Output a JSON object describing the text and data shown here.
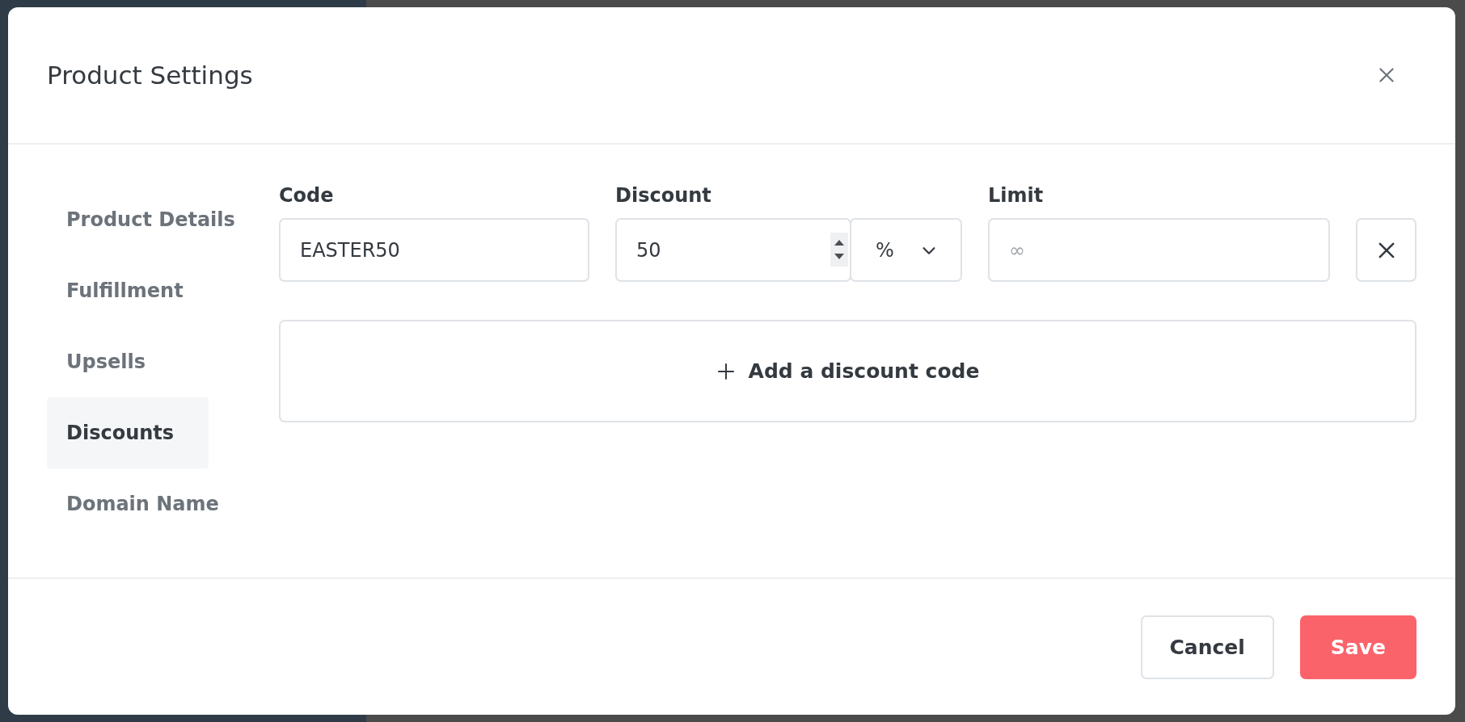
{
  "dialog": {
    "title": "Product Settings"
  },
  "sidebar": {
    "items": [
      {
        "label": "Product Details",
        "selected": false
      },
      {
        "label": "Fulfillment",
        "selected": false
      },
      {
        "label": "Upsells",
        "selected": false
      },
      {
        "label": "Discounts",
        "selected": true
      },
      {
        "label": "Domain Name",
        "selected": false
      }
    ]
  },
  "discount_codes": {
    "columns": [
      "Code",
      "Discount",
      "Limit"
    ],
    "rows": [
      {
        "code": "EASTER50",
        "discount": "50",
        "unit": "%",
        "limit_placeholder": "∞"
      }
    ]
  },
  "add_button": {
    "label": "Add a discount code"
  },
  "footer": {
    "buttons": [
      {
        "label": "Cancel",
        "kind": "secondary"
      },
      {
        "label": "Save",
        "kind": "primary"
      }
    ]
  }
}
